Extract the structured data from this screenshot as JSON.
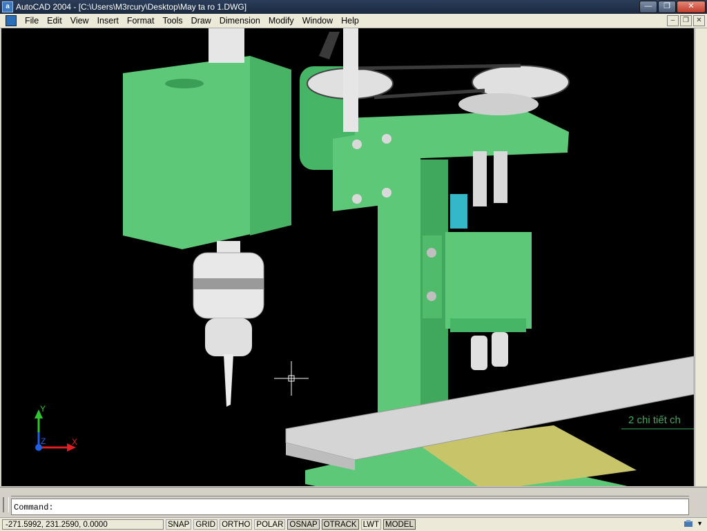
{
  "window": {
    "app_icon": "a",
    "title": "AutoCAD 2004 - [C:\\Users\\M3rcury\\Desktop\\May ta ro 1.DWG]"
  },
  "menu": {
    "items": [
      "File",
      "Edit",
      "View",
      "Insert",
      "Format",
      "Tools",
      "Draw",
      "Dimension",
      "Modify",
      "Window",
      "Help"
    ]
  },
  "drawing": {
    "annotation": "2 chi tiết ch",
    "ucs": {
      "x": "X",
      "y": "Y",
      "z": "Z"
    },
    "colors": {
      "machine": "#5dc878",
      "metal": "#d9d9d9",
      "base": "#c8c46a",
      "background": "#000000"
    }
  },
  "command": {
    "prompt": "Command:"
  },
  "status": {
    "coords": "-271.5992, 231.2590, 0.0000",
    "toggles": [
      {
        "label": "SNAP",
        "on": false
      },
      {
        "label": "GRID",
        "on": false
      },
      {
        "label": "ORTHO",
        "on": false
      },
      {
        "label": "POLAR",
        "on": false
      },
      {
        "label": "OSNAP",
        "on": true
      },
      {
        "label": "OTRACK",
        "on": true
      },
      {
        "label": "LWT",
        "on": false
      },
      {
        "label": "MODEL",
        "on": true
      }
    ]
  }
}
